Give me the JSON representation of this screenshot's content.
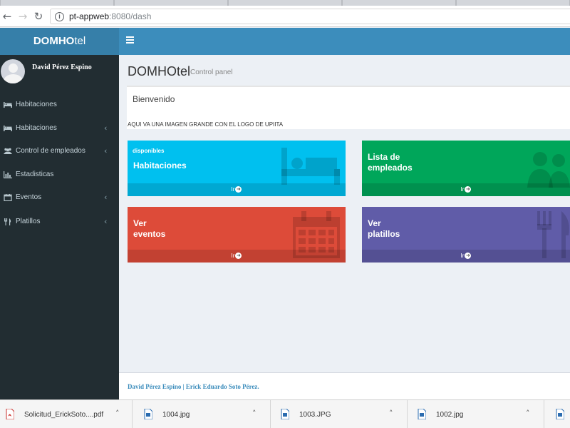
{
  "browser": {
    "url_host": "pt-appweb",
    "url_path": ":8080/dash",
    "back_icon": "back-arrow-icon",
    "forward_icon": "forward-arrow-icon",
    "reload_icon": "reload-icon"
  },
  "header": {
    "brand_bold": "DOMHO",
    "brand_light": "tel",
    "color": "#3c8dbc"
  },
  "sidebar": {
    "user_name": "David Pérez Espino",
    "items": [
      {
        "label": "Habitaciones",
        "icon": "bed-icon",
        "has_children": false
      },
      {
        "label": "Habitaciones",
        "icon": "bed-icon",
        "has_children": true
      },
      {
        "label": "Control de empleados",
        "icon": "users-icon",
        "has_children": true
      },
      {
        "label": "Estadisticas",
        "icon": "bar-chart-icon",
        "has_children": false
      },
      {
        "label": "Eventos",
        "icon": "calendar-icon",
        "has_children": true
      },
      {
        "label": "Platillos",
        "icon": "cutlery-icon",
        "has_children": true
      }
    ]
  },
  "main": {
    "title": "DOMHOtel",
    "subtitle": "Control panel",
    "welcome_title": "Bienvenido",
    "welcome_note": "AQUI VA UNA IMAGEN GRANDE CON EL LOGO DE UPIITA",
    "boxes": [
      {
        "sub": "disponibles",
        "title": "Habitaciones",
        "link": "Ir",
        "color": "#00c0ef",
        "icon": "bed-icon"
      },
      {
        "sub": "",
        "title": "Lista de\nempleados",
        "link": "Ir",
        "color": "#00a65a",
        "icon": "users-icon"
      },
      {
        "sub": "",
        "title": "Ver\neventos",
        "link": "Ir",
        "color": "#dd4b39",
        "icon": "calendar-icon"
      },
      {
        "sub": "",
        "title": "Ver\nplatillos",
        "link": "Ir",
        "color": "#605ca8",
        "icon": "cutlery-icon"
      }
    ]
  },
  "footer": {
    "text": "David Pérez Espino | Erick Eduardo Soto Pérez."
  },
  "downloads": [
    {
      "name": "Solicitud_ErickSoto....pdf",
      "icon": "pdf-file-icon"
    },
    {
      "name": "1004.jpg",
      "icon": "image-file-icon"
    },
    {
      "name": "1003.JPG",
      "icon": "image-file-icon"
    },
    {
      "name": "1002.jpg",
      "icon": "image-file-icon"
    }
  ]
}
